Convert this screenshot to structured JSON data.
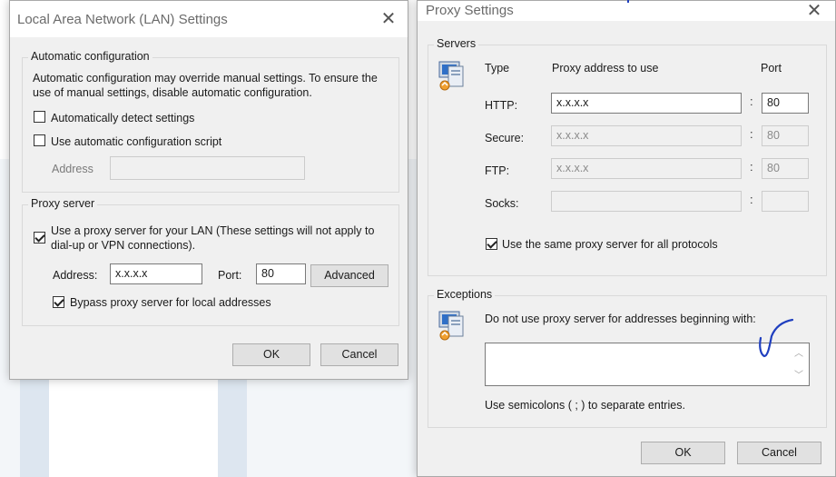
{
  "lan": {
    "title": "Local Area Network (LAN) Settings",
    "auto_config": {
      "label": "Automatic configuration",
      "description": "Automatic configuration may override manual settings.  To ensure the use of manual settings, disable automatic configuration.",
      "detect_label": "Automatically detect settings",
      "detect_checked": false,
      "script_label": "Use automatic configuration script",
      "script_checked": false,
      "address_label": "Address",
      "address_value": ""
    },
    "proxy": {
      "label": "Proxy server",
      "use_proxy_label": "Use a proxy server for your LAN (These settings will not apply to dial-up or VPN connections).",
      "use_proxy_checked": true,
      "address_label": "Address:",
      "address_value": "x.x.x.x",
      "port_label": "Port:",
      "port_value": "80",
      "advanced_label": "Advanced",
      "bypass_label": "Bypass proxy server for local addresses",
      "bypass_checked": true
    },
    "ok_label": "OK",
    "cancel_label": "Cancel"
  },
  "proxy_settings": {
    "title": "Proxy Settings",
    "servers": {
      "label": "Servers",
      "col_type": "Type",
      "col_address": "Proxy address to use",
      "col_port": "Port",
      "rows": [
        {
          "type": "HTTP:",
          "address": "x.x.x.x",
          "port": "80",
          "enabled": true
        },
        {
          "type": "Secure:",
          "address": "x.x.x.x",
          "port": "80",
          "enabled": false
        },
        {
          "type": "FTP:",
          "address": "x.x.x.x",
          "port": "80",
          "enabled": false
        },
        {
          "type": "Socks:",
          "address": "",
          "port": "",
          "enabled": false
        }
      ],
      "colon": ":",
      "same_proxy_label": "Use the same proxy server for all protocols",
      "same_proxy_checked": true
    },
    "exceptions": {
      "label": "Exceptions",
      "description": "Do not use proxy server for addresses beginning with:",
      "value": "",
      "hint": "Use semicolons ( ; ) to separate entries."
    },
    "ok_label": "OK",
    "cancel_label": "Cancel"
  },
  "icons": {
    "close": "close-icon",
    "computer": "computer-network-icon",
    "scroll_up": "scroll-up-icon",
    "scroll_down": "scroll-down-icon"
  },
  "colors": {
    "dialog_bg": "#f0f0f0",
    "annotation": "#1f3fbf"
  }
}
